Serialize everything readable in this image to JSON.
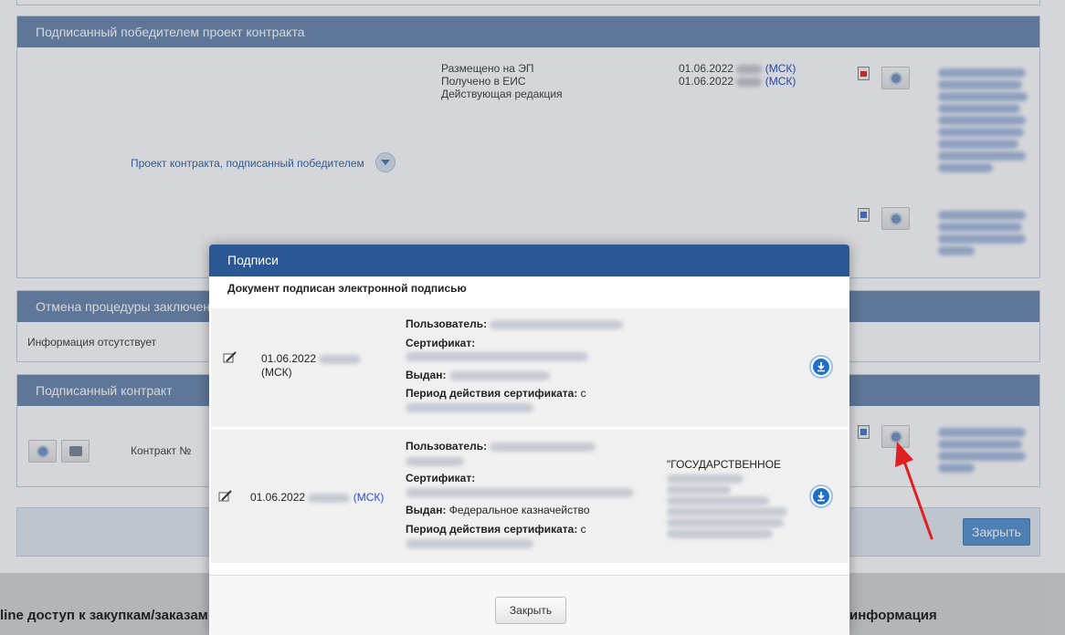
{
  "background": {
    "panel_signed_project": {
      "title": "Подписанный победителем проект контракта",
      "doc_link": "Проект контракта, подписанный победителем",
      "status_labels": [
        "Размещено на ЭП",
        "Получено в ЕИС",
        "Действующая редакция"
      ],
      "dates": [
        "01.06.2022",
        "01.06.2022"
      ],
      "tz": "(МСК)"
    },
    "panel_cancel": {
      "title": "Отмена процедуры заключения контракта",
      "info": "Информация отсутствует"
    },
    "panel_signed_contract": {
      "title": "Подписанный контракт",
      "contract_label": "Контракт №"
    },
    "close_button": "Закрыть",
    "footer_left": "line доступ к закупкам/заказам",
    "footer_right": "информация"
  },
  "modal": {
    "title": "Подписи",
    "subtitle": "Документ подписан электронной подписью",
    "labels": {
      "user": "Пользователь:",
      "certificate": "Сертификат:",
      "issued": "Выдан:",
      "period": "Период действия сертификата:",
      "period_prefix": "с"
    },
    "signatures": [
      {
        "date": "01.06.2022",
        "tz": "(МСК)",
        "issuer": ""
      },
      {
        "date": "01.06.2022",
        "tz": "(МСК)",
        "issuer": "Федеральное казначейство",
        "org": "\"ГОСУДАРСТВЕННОЕ"
      }
    ],
    "close_button": "Закрыть"
  },
  "colors": {
    "modal_header": "#2b5794",
    "panel_header": "#6e8cb0",
    "accent_blue": "#1e6fc8",
    "arrow": "#e02020"
  }
}
